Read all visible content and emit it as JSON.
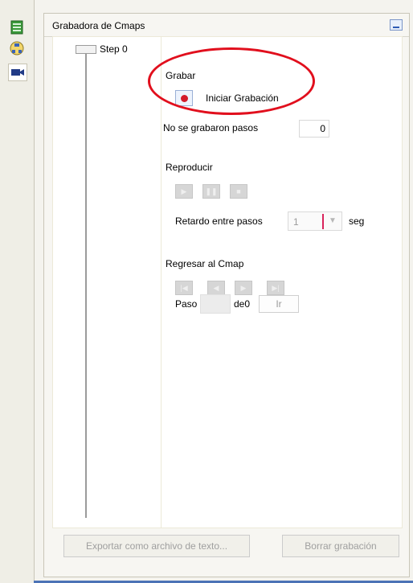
{
  "sidebar": {
    "icons": [
      "list-icon",
      "concept-map-icon",
      "recorder-icon"
    ]
  },
  "panel": {
    "title": "Grabadora de Cmaps"
  },
  "steps": [
    {
      "label": "Step 0"
    }
  ],
  "record": {
    "section_label": "Grabar",
    "start_button_label": "Iniciar Grabación",
    "no_steps_label": "No se grabaron pasos",
    "step_count": "0"
  },
  "playback": {
    "section_label": "Reproducir",
    "delay_label": "Retardo entre pasos",
    "delay_value": "1",
    "delay_unit": "seg"
  },
  "return_to_cmap": {
    "section_label": "Regresar al Cmap",
    "step_label": "Paso",
    "of_label": "de0",
    "go_button_label": "Ir"
  },
  "footer": {
    "export_button": "Exportar como archivo de texto...",
    "delete_button": "Borrar grabación"
  },
  "colors": {
    "highlight_ellipse": "#e10f1d",
    "record_dot": "#d31b2a",
    "accent_line": "#4c73b6"
  }
}
